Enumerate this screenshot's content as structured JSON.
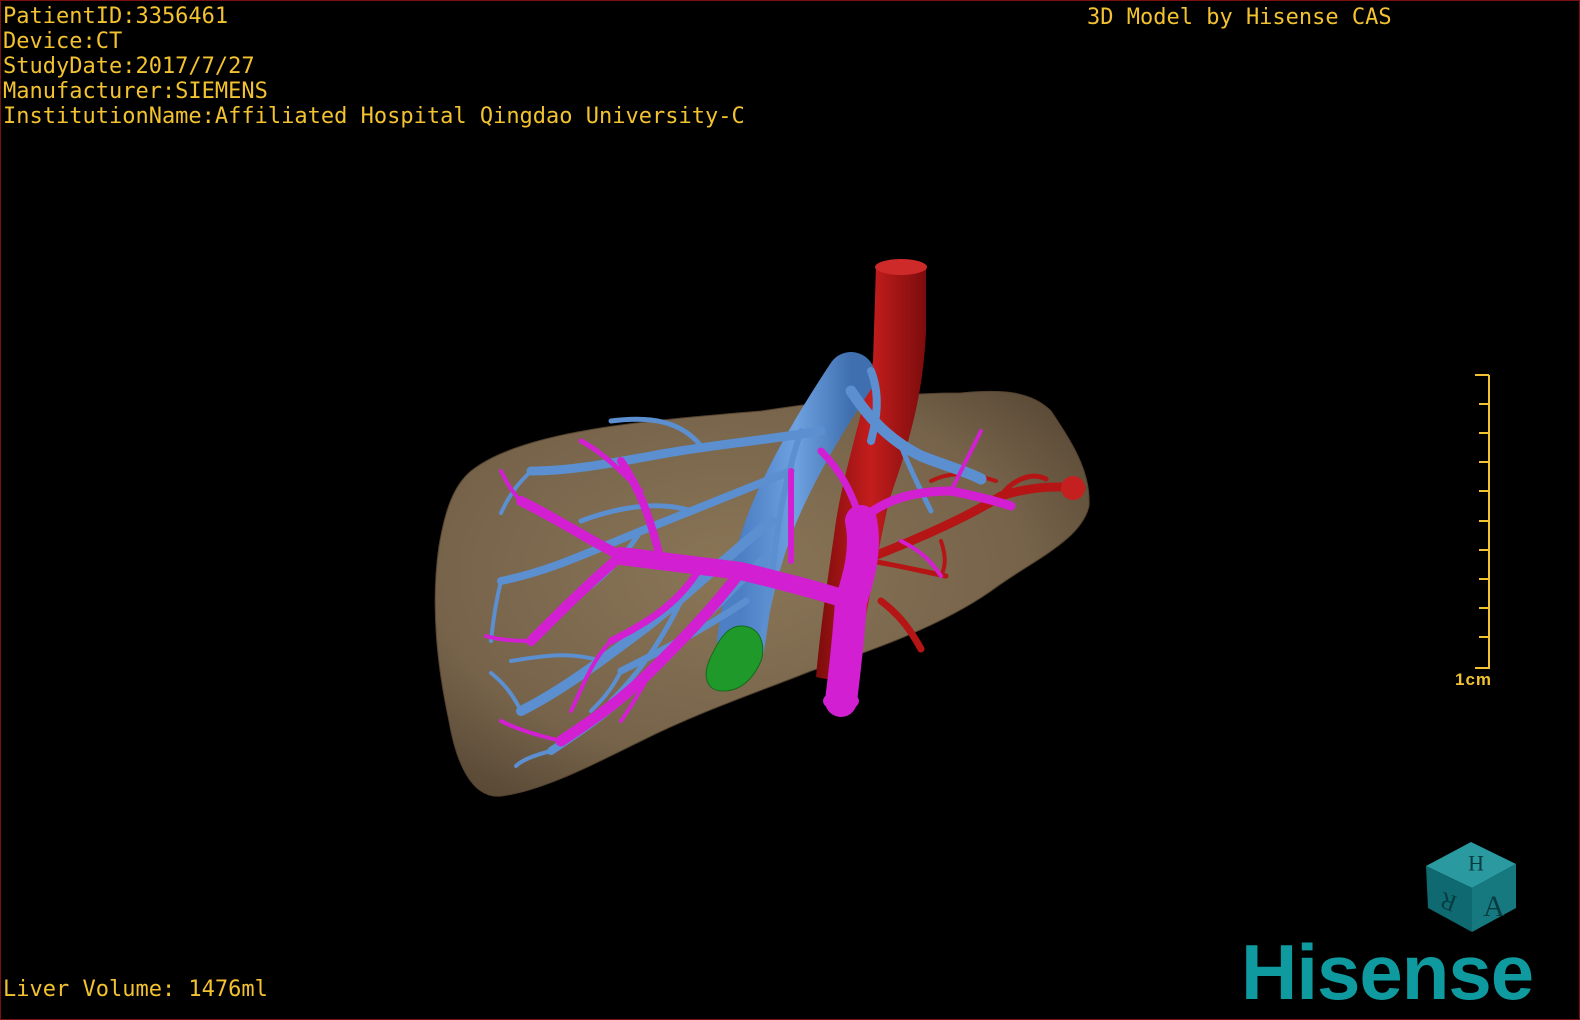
{
  "header": {
    "patient_id": "PatientID:3356461",
    "device": "Device:CT",
    "study_date": "StudyDate:2017/7/27",
    "manufacturer": "Manufacturer:SIEMENS",
    "institution": "InstitutionName:Affiliated Hospital Qingdao University-C",
    "credit": "3D Model by Hisense CAS"
  },
  "footer": {
    "liver_volume": "Liver Volume: 1476ml"
  },
  "scale_bar": {
    "label": "1cm"
  },
  "orientation_cube": {
    "faces": [
      "H",
      "R",
      "A"
    ],
    "color": "#15797f"
  },
  "brand": {
    "logo_text": "Hisense",
    "color": "#0f9aa0"
  },
  "colors": {
    "text": "#f2c230",
    "liver": "#7d6a4f",
    "hepatic_vein": "#5b8fd0",
    "portal_vein": "#d21fd2",
    "artery_vena_cava": "#b51515",
    "gallbladder": "#1f9a2a"
  }
}
